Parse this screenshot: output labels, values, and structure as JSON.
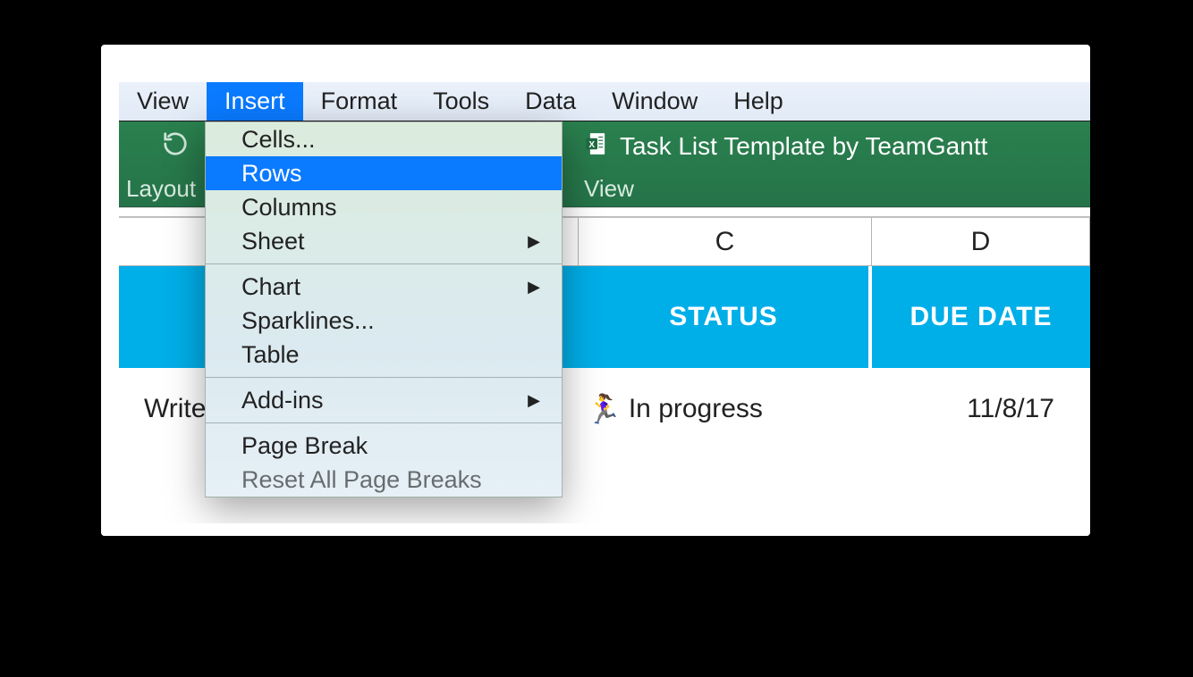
{
  "menubar": {
    "items": [
      {
        "label": "View",
        "active": false
      },
      {
        "label": "Insert",
        "active": true
      },
      {
        "label": "Format",
        "active": false
      },
      {
        "label": "Tools",
        "active": false
      },
      {
        "label": "Data",
        "active": false
      },
      {
        "label": "Window",
        "active": false
      },
      {
        "label": "Help",
        "active": false
      }
    ]
  },
  "ribbon": {
    "layout_label": "Layout",
    "workbook_title": "Task List Template by TeamGantt",
    "view_label": "View"
  },
  "dropdown": {
    "groups": [
      [
        {
          "label": "Cells...",
          "submenu": false,
          "highlight": false
        },
        {
          "label": "Rows",
          "submenu": false,
          "highlight": true
        },
        {
          "label": "Columns",
          "submenu": false,
          "highlight": false
        },
        {
          "label": "Sheet",
          "submenu": true,
          "highlight": false
        }
      ],
      [
        {
          "label": "Chart",
          "submenu": true,
          "highlight": false
        },
        {
          "label": "Sparklines...",
          "submenu": false,
          "highlight": false
        },
        {
          "label": "Table",
          "submenu": false,
          "highlight": false
        }
      ],
      [
        {
          "label": "Add-ins",
          "submenu": true,
          "highlight": false
        }
      ],
      [
        {
          "label": "Page Break",
          "submenu": false,
          "highlight": false
        },
        {
          "label": "Reset All Page Breaks",
          "submenu": false,
          "highlight": false,
          "faded": true
        }
      ]
    ]
  },
  "columns": {
    "c": "C",
    "d": "D"
  },
  "header": {
    "status": "STATUS",
    "due_date": "DUE DATE"
  },
  "row": {
    "task": "Write",
    "status_icon": "🏃‍♀️",
    "status_text": "In progress",
    "due_date": "11/8/17"
  }
}
